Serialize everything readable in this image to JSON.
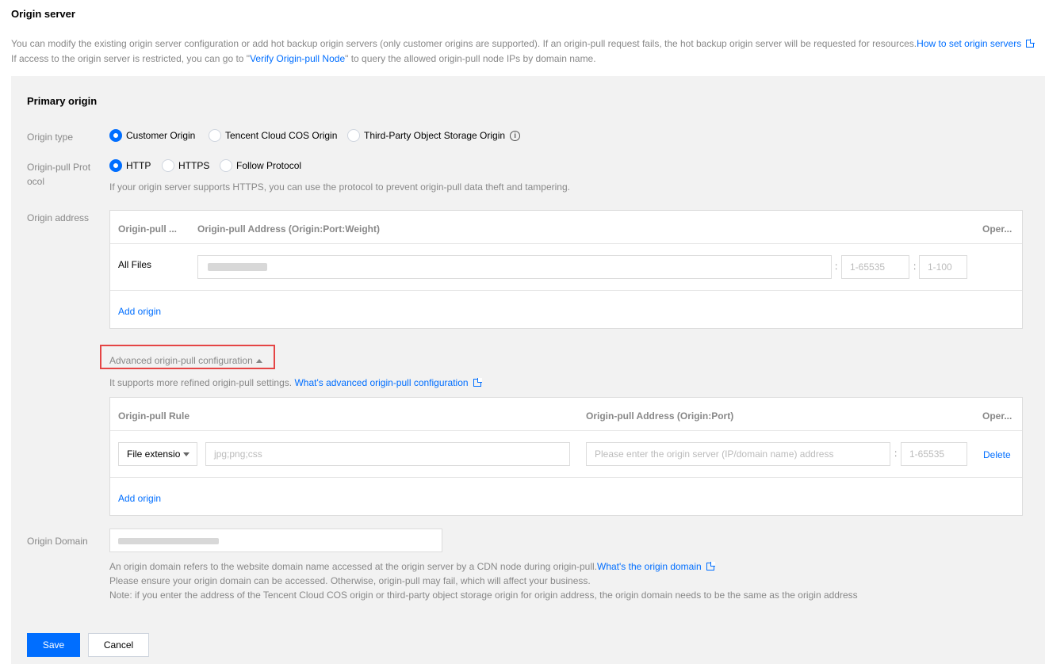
{
  "page": {
    "title": "Origin server",
    "desc_line1": "You can modify the existing origin server configuration or add hot backup origin servers (only customer origins are supported). If an origin-pull request fails, the hot backup origin server will be requested for resources.",
    "desc_line1_link": "How to set origin servers",
    "desc_line2_pre": "If access to the origin server is restricted, you can go to \"",
    "desc_line2_link": "Verify Origin-pull Node",
    "desc_line2_post": "\" to query the allowed origin-pull node IPs by domain name."
  },
  "primary": {
    "title": "Primary origin",
    "origin_type_label": "Origin type",
    "origin_types": [
      "Customer Origin",
      "Tencent Cloud COS Origin",
      "Third-Party Object Storage Origin"
    ],
    "protocol_label_1": "Origin-pull Prot",
    "protocol_label_2": "ocol",
    "protocols": [
      "HTTP",
      "HTTPS",
      "Follow Protocol"
    ],
    "protocol_help": "If your origin server supports HTTPS, you can use the protocol to prevent origin-pull data theft and tampering.",
    "address_label": "Origin address"
  },
  "address_table": {
    "col1": "Origin-pull ...",
    "col2": "Origin-pull Address (Origin:Port:Weight)",
    "col3": "Oper...",
    "row_label": "All Files",
    "port_placeholder": "1-65535",
    "weight_placeholder": "1-100",
    "add_link": "Add origin"
  },
  "advanced": {
    "toggle_label": "Advanced origin-pull configuration",
    "help_text": "It supports more refined origin-pull settings.",
    "help_link": "What's advanced origin-pull configuration"
  },
  "advanced_table": {
    "col1": "Origin-pull Rule",
    "col2": "Origin-pull Address (Origin:Port)",
    "col3": "Oper...",
    "rule_select": "File extensio",
    "rule_placeholder": "jpg;png;css",
    "address_placeholder": "Please enter the origin server (IP/domain name) address",
    "port_placeholder": "1-65535",
    "delete_link": "Delete",
    "add_link": "Add origin"
  },
  "origin_domain": {
    "label": "Origin Domain",
    "help_line1": "An origin domain refers to the website domain name accessed at the origin server by a CDN node during origin-pull.",
    "help_line1_link": "What's the origin domain",
    "help_line2": "Please ensure your origin domain can be accessed. Otherwise, origin-pull may fail, which will affect your business.",
    "help_line3": "Note: if you enter the address of the Tencent Cloud COS origin or third-party object storage origin for origin address, the origin domain needs to be the same as the origin address"
  },
  "buttons": {
    "save": "Save",
    "cancel": "Cancel"
  },
  "colors": {
    "accent": "#006eff",
    "highlight_border": "#e54545"
  }
}
